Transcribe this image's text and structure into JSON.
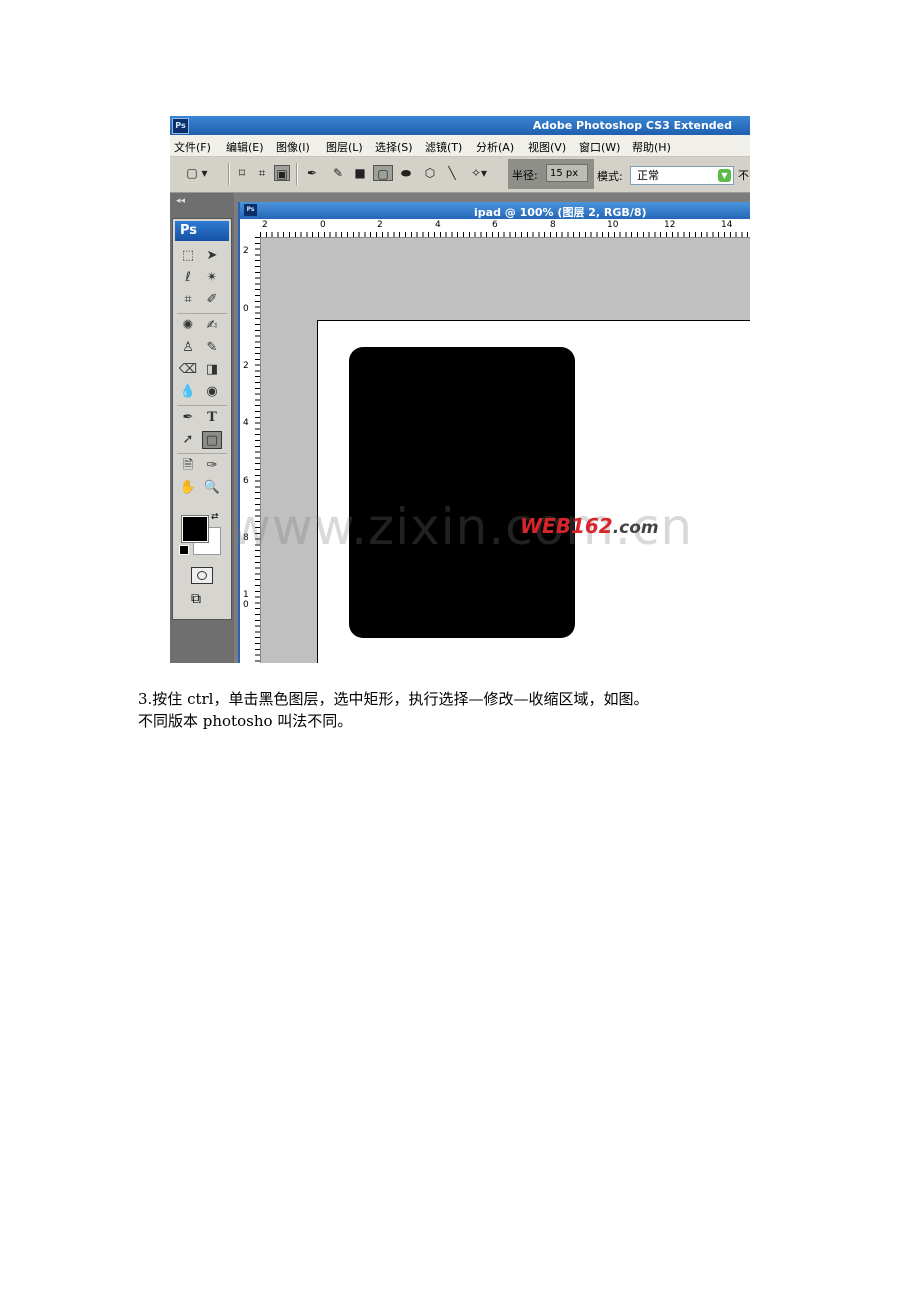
{
  "app": {
    "badge": "Ps",
    "title": "Adobe Photoshop CS3 Extended"
  },
  "menu": [
    "文件(F)",
    "编辑(E)",
    "图像(I)",
    "图层(L)",
    "选择(S)",
    "滤镜(T)",
    "分析(A)",
    "视图(V)",
    "窗口(W)",
    "帮助(H)"
  ],
  "options": {
    "radius_label": "半径:",
    "radius_value": "15 px",
    "mode_label": "模式:",
    "mode_value": "正常",
    "trailing": "不"
  },
  "toolbox": {
    "header": "Ps",
    "collapse": "◂◂",
    "type_tool": "T"
  },
  "document": {
    "badge": "Ps",
    "title": "ipad @ 100% (图层 2, RGB/8)",
    "hruler_labels": [
      "2",
      "0",
      "2",
      "4",
      "6",
      "8",
      "10",
      "12",
      "14"
    ],
    "vruler_labels": [
      "2",
      "0",
      "2",
      "4",
      "6",
      "8",
      "1\n0"
    ]
  },
  "overlay": {
    "watermark": "www.zixin.com.cn",
    "logo_main": "WEB162",
    "logo_suffix": ".com"
  },
  "caption": {
    "line1": "3.按住 ctrl，单击黑色图层，选中矩形，执行选择—修改—收缩区域，如图。",
    "line2": "不同版本 photosho 叫法不同。"
  },
  "colors": {
    "foreground": "#000000",
    "background": "#ffffff",
    "titlebar": "#2466b6"
  }
}
